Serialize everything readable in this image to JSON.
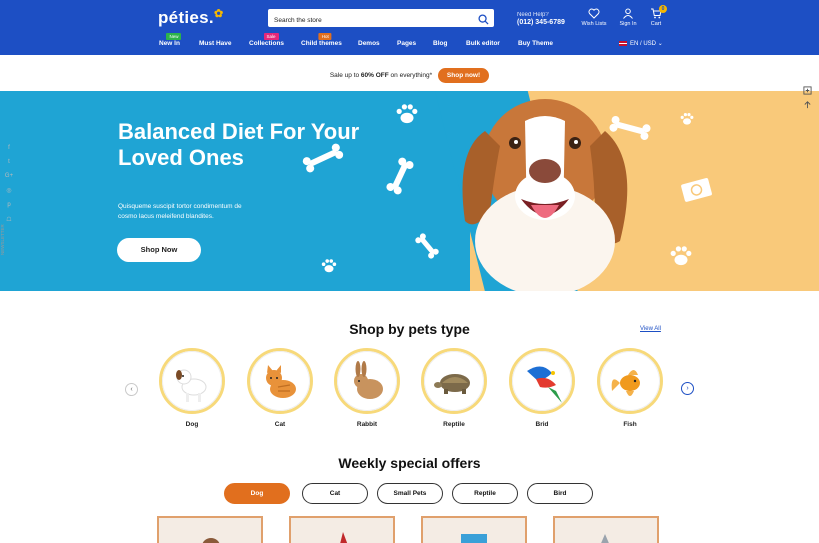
{
  "header": {
    "logo": "péties.",
    "search_placeholder": "Search the store",
    "help_label": "Need Help?",
    "help_phone": "(012) 345-6789",
    "wishlist_label": "Wish Lists",
    "signin_label": "Sign In",
    "cart_label": "Cart",
    "cart_count": "0",
    "lang_label": "EN / USD"
  },
  "nav": {
    "items": [
      {
        "label": "New In",
        "badge": "New",
        "badge_color": "#2db34a"
      },
      {
        "label": "Must Have",
        "badge": "",
        "badge_color": ""
      },
      {
        "label": "Collections",
        "badge": "Sale",
        "badge_color": "#e5287a"
      },
      {
        "label": "Child themes",
        "badge": "Hot",
        "badge_color": "#e16f1e"
      },
      {
        "label": "Demos",
        "badge": "",
        "badge_color": ""
      },
      {
        "label": "Pages",
        "badge": "",
        "badge_color": ""
      },
      {
        "label": "Blog",
        "badge": "",
        "badge_color": ""
      },
      {
        "label": "Bulk editor",
        "badge": "",
        "badge_color": ""
      },
      {
        "label": "Buy Theme",
        "badge": "",
        "badge_color": ""
      }
    ]
  },
  "promo": {
    "text_before": "Sale up to ",
    "text_bold": "60% OFF",
    "text_after": " on everything*",
    "button": "Shop now!"
  },
  "hero": {
    "title": "Balanced Diet For Your Loved Ones",
    "subtitle": "Quisqueme suscipit tortor condimentum de cosmo lacus meleifend blandites.",
    "button": "Shop Now",
    "newsletter": "NEWSLETTER"
  },
  "pets_section": {
    "title": "Shop by pets type",
    "view_all": "View All",
    "pets": [
      {
        "name": "Dog",
        "icon": "dog-icon"
      },
      {
        "name": "Cat",
        "icon": "cat-icon"
      },
      {
        "name": "Rabbit",
        "icon": "rabbit-icon"
      },
      {
        "name": "Reptile",
        "icon": "reptile-icon"
      },
      {
        "name": "Brid",
        "icon": "bird-icon"
      },
      {
        "name": "Fish",
        "icon": "fish-icon"
      }
    ]
  },
  "offers_section": {
    "title": "Weekly special offers",
    "filters": [
      "Dog",
      "Cat",
      "Small Pets",
      "Reptile",
      "Bird"
    ],
    "active_filter": "Dog"
  },
  "colors": {
    "brand_blue": "#1d4fc4",
    "accent_orange": "#e16f1e",
    "hero_blue": "#1fa4d4",
    "hero_peach": "#f9c97a"
  }
}
